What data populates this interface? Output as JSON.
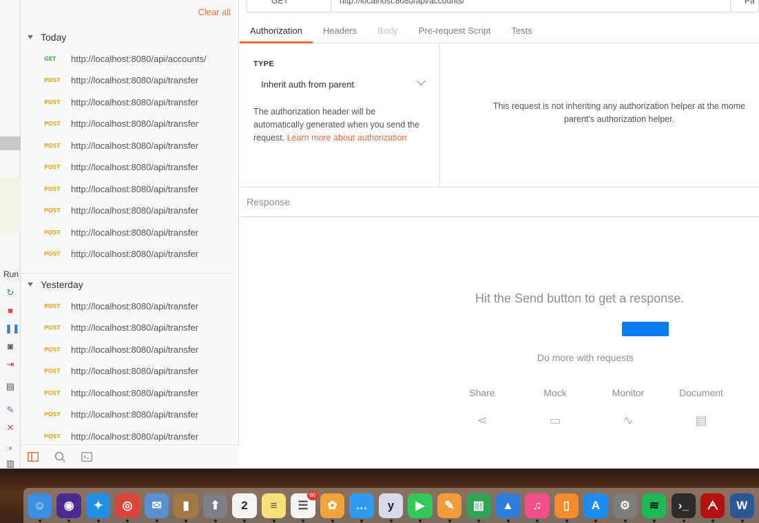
{
  "sidebar": {
    "clear_all": "Clear all",
    "groups": [
      {
        "label": "Today",
        "requests": [
          {
            "method": "GET",
            "url": "http://localhost:8080/api/accounts/"
          },
          {
            "method": "POST",
            "url": "http://localhost:8080/api/transfer"
          },
          {
            "method": "POST",
            "url": "http://localhost:8080/api/transfer"
          },
          {
            "method": "POST",
            "url": "http://localhost:8080/api/transfer"
          },
          {
            "method": "POST",
            "url": "http://localhost:8080/api/transfer"
          },
          {
            "method": "POST",
            "url": "http://localhost:8080/api/transfer"
          },
          {
            "method": "POST",
            "url": "http://localhost:8080/api/transfer"
          },
          {
            "method": "POST",
            "url": "http://localhost:8080/api/transfer"
          },
          {
            "method": "POST",
            "url": "http://localhost:8080/api/transfer"
          },
          {
            "method": "POST",
            "url": "http://localhost:8080/api/transfer"
          }
        ]
      },
      {
        "label": "Yesterday",
        "requests": [
          {
            "method": "POST",
            "url": "http://localhost:8080/api/transfer"
          },
          {
            "method": "POST",
            "url": "http://localhost:8080/api/transfer"
          },
          {
            "method": "POST",
            "url": "http://localhost:8080/api/transfer"
          },
          {
            "method": "POST",
            "url": "http://localhost:8080/api/transfer"
          },
          {
            "method": "POST",
            "url": "http://localhost:8080/api/transfer"
          },
          {
            "method": "POST",
            "url": "http://localhost:8080/api/transfer"
          },
          {
            "method": "POST",
            "url": "http://localhost:8080/api/transfer"
          }
        ]
      }
    ]
  },
  "ide": {
    "run_label": "Run"
  },
  "request": {
    "method": "GET",
    "url": "http://localhost:8080/api/accounts/",
    "params_label": "Pa"
  },
  "tabs": [
    {
      "label": "Authorization",
      "state": "active"
    },
    {
      "label": "Headers",
      "state": "normal"
    },
    {
      "label": "Body",
      "state": "disabled"
    },
    {
      "label": "Pre-request Script",
      "state": "normal"
    },
    {
      "label": "Tests",
      "state": "normal"
    }
  ],
  "auth": {
    "type_label": "TYPE",
    "selected": "Inherit auth from parent",
    "desc": "The authorization header will be automatically generated when you send the request. ",
    "link": "Learn more about authorization",
    "message_line1": "This request is not inheriting any authorization helper at the mome",
    "message_line2": "parent's authorization helper."
  },
  "response": {
    "label": "Response",
    "hint": "Hit the Send button to get a response.",
    "do_more": "Do more with requests",
    "features": [
      {
        "label": "Share",
        "icon": "share-icon",
        "glyph": "⋖"
      },
      {
        "label": "Mock",
        "icon": "server-icon",
        "glyph": "▭"
      },
      {
        "label": "Monitor",
        "icon": "pulse-icon",
        "glyph": "∿"
      },
      {
        "label": "Document",
        "icon": "document-icon",
        "glyph": "▤"
      }
    ]
  },
  "dock": {
    "apps": [
      {
        "name": "finder",
        "glyph": "☺",
        "color": "#3b8fe0"
      },
      {
        "name": "siri",
        "glyph": "◉",
        "color": "#4b2c8e"
      },
      {
        "name": "safari",
        "glyph": "✦",
        "color": "#1f8fe8"
      },
      {
        "name": "chrome",
        "glyph": "◎",
        "color": "#d9453b"
      },
      {
        "name": "mail",
        "glyph": "✉",
        "color": "#5a8fd0"
      },
      {
        "name": "notes-book",
        "glyph": "▮",
        "color": "#a07840"
      },
      {
        "name": "launchpad",
        "glyph": "⬆",
        "color": "#7a7f88"
      },
      {
        "name": "calendar",
        "glyph": "2",
        "color": "#f4f4f4",
        "text": "#222"
      },
      {
        "name": "notes",
        "glyph": "≡",
        "color": "#f7e27a",
        "text": "#555"
      },
      {
        "name": "reminders",
        "glyph": "☰",
        "color": "#f4f4f4",
        "text": "#555",
        "badge": "60"
      },
      {
        "name": "photos",
        "glyph": "✿",
        "color": "#f2a33a"
      },
      {
        "name": "messages",
        "glyph": "…",
        "color": "#2d9cf0"
      },
      {
        "name": "yoink",
        "glyph": "y",
        "color": "#d6dde8",
        "text": "#222"
      },
      {
        "name": "facetime",
        "glyph": "▶",
        "color": "#34c759"
      },
      {
        "name": "pages",
        "glyph": "✎",
        "color": "#f29b3a"
      },
      {
        "name": "numbers",
        "glyph": "▥",
        "color": "#31a354"
      },
      {
        "name": "keynote",
        "glyph": "▲",
        "color": "#2f7bd9"
      },
      {
        "name": "itunes",
        "glyph": "♫",
        "color": "#f34e8c"
      },
      {
        "name": "books",
        "glyph": "▯",
        "color": "#f28b2a"
      },
      {
        "name": "app-store",
        "glyph": "A",
        "color": "#1d8ef0"
      },
      {
        "name": "system-preferences",
        "glyph": "⚙",
        "color": "#7c7c7c"
      },
      {
        "name": "spotify",
        "glyph": "≋",
        "color": "#1db954",
        "text": "#111"
      },
      {
        "name": "terminal",
        "glyph": "›_",
        "color": "#2a2a2a"
      },
      {
        "name": "acrobat",
        "glyph": "ᗅ",
        "color": "#b3120f"
      },
      {
        "name": "word",
        "glyph": "W",
        "color": "#2b5797"
      }
    ]
  }
}
